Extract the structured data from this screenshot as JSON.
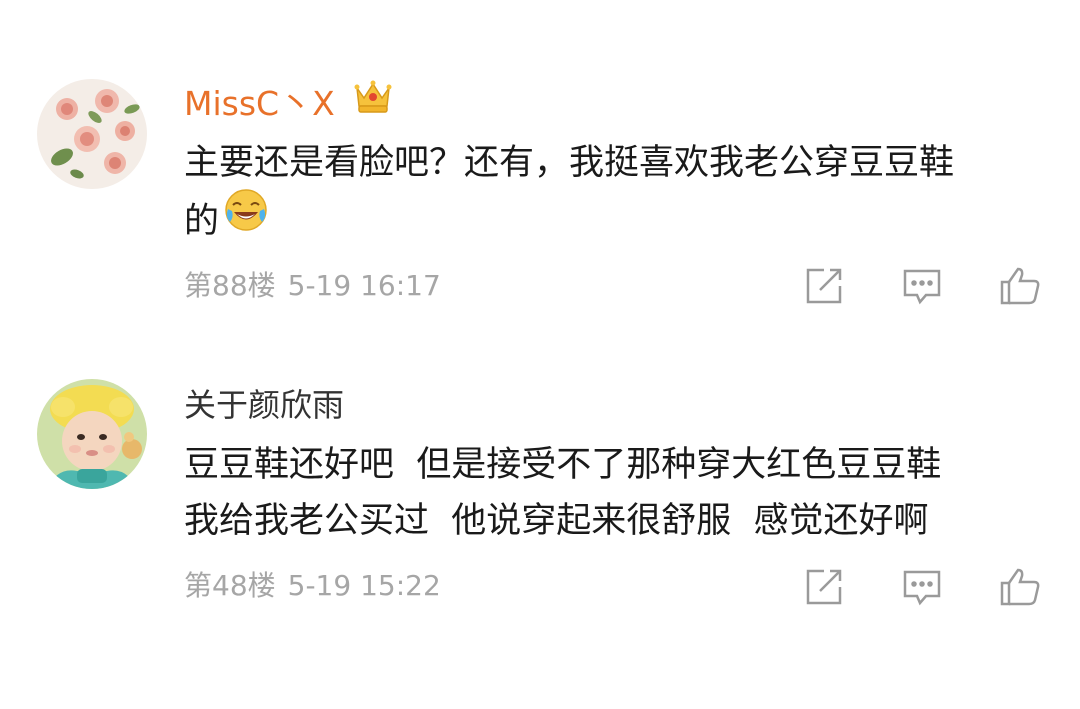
{
  "comments": [
    {
      "username": "MissC丶X",
      "badge_icon": "crown-icon",
      "lines": [
        "主要还是看脸吧？还有，我挺喜欢我老公穿豆豆鞋",
        "的"
      ],
      "inline_emoji": "laughing-crying-emoji-icon",
      "floor": "第88楼",
      "time": "5-19 16:17",
      "avatar_icon": "roses-avatar"
    },
    {
      "username": "关于颜欣雨",
      "lines": [
        "豆豆鞋还好吧  但是接受不了那种穿大红色豆豆鞋",
        "我给我老公买过  他说穿起来很舒服  感觉还好啊"
      ],
      "floor": "第48楼",
      "time": "5-19 15:22",
      "avatar_icon": "baby-avatar"
    }
  ],
  "actions": [
    "share-icon",
    "reply-icon",
    "like-icon"
  ],
  "colors": {
    "vip_username": "#e8712a",
    "username": "#333333",
    "meta": "#a6a6a6",
    "icon": "#9a9a9a"
  }
}
